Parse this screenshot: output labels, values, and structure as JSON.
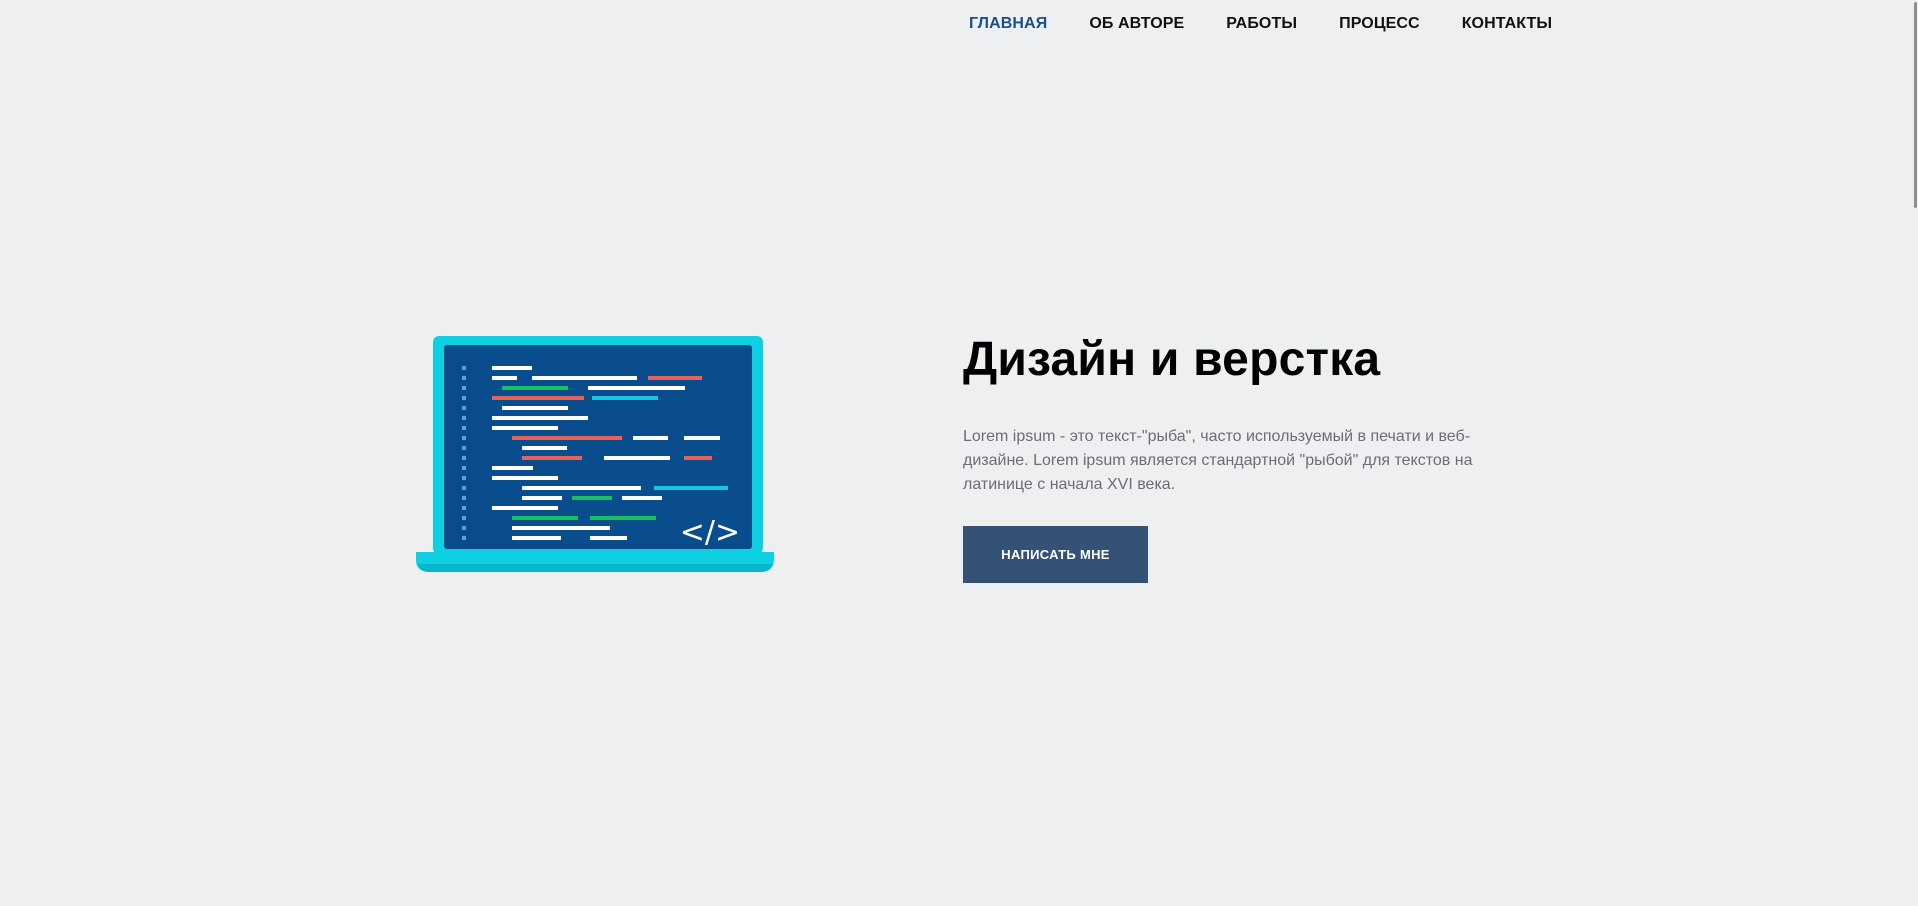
{
  "nav": {
    "items": [
      {
        "label": "ГЛАВНАЯ",
        "active": true
      },
      {
        "label": "ОБ АВТОРЕ",
        "active": false
      },
      {
        "label": "РАБОТЫ",
        "active": false
      },
      {
        "label": "ПРОЦЕСС",
        "active": false
      },
      {
        "label": "КОНТАКТЫ",
        "active": false
      }
    ]
  },
  "hero": {
    "title": "Дизайн и верстка",
    "text": "Lorem ipsum - это текст-\"рыба\", часто используемый в печати и веб-дизайне. Lorem ipsum является стандартной \"рыбой\" для текстов на латинице с начала XVI века.",
    "button_label": "НАПИСАТЬ МНЕ"
  },
  "illustration": {
    "code_symbol": "</>",
    "icon": "laptop-code-icon"
  },
  "colors": {
    "background": "#eeeff1",
    "nav_active": "#1b4f8a",
    "button": "#345276",
    "laptop_frame": "#0fd0e0",
    "laptop_screen": "#0a4d8c",
    "code_red": "#e8625a",
    "code_green": "#17c060",
    "code_cyan": "#14c8e2"
  }
}
